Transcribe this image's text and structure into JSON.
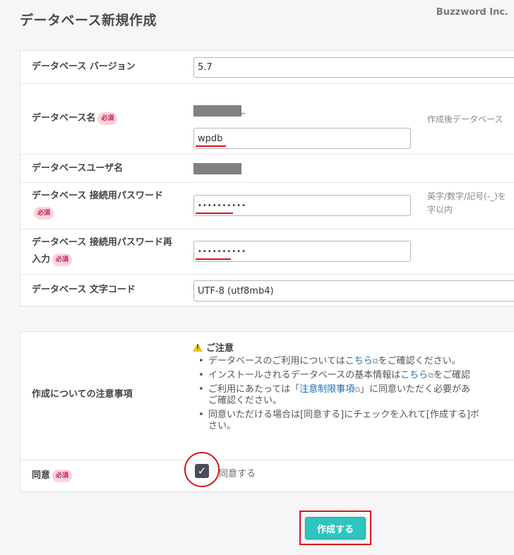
{
  "page": {
    "title": "データベース新規作成",
    "brand": "Buzzword Inc."
  },
  "form": {
    "required_badge": "必須",
    "version": {
      "label": "データベース バージョン",
      "value": "5.7"
    },
    "db_name": {
      "label": "データベース名",
      "prefix_suffix": "_",
      "value": "wpdb",
      "hint": "作成後データベース"
    },
    "db_user": {
      "label": "データベースユーザ名"
    },
    "password": {
      "label": "データベース 接続用パスワード",
      "value": "••••••••••",
      "hint_line1": "英字/数字/記号(-_)を",
      "hint_line2": "字以内"
    },
    "password_confirm": {
      "label": "データベース 接続用パスワード再入力",
      "value": "••••••••••"
    },
    "charset": {
      "label": "データベース 文字コード",
      "value": "UTF-8 (utf8mb4)"
    }
  },
  "notice": {
    "label": "作成についての注意事項",
    "title": "ご注意",
    "items": [
      {
        "before": "データベースのご利用については",
        "link": "こちら",
        "after": "をご確認ください。"
      },
      {
        "before": "インストールされるデータベースの基本情報は",
        "link": "こちら",
        "after": "をご確認"
      },
      {
        "before": "ご利用にあたっては「",
        "link": "注意制限事項",
        "after": "」に同意いただく必要があ",
        "line2": "ご確認ください。"
      },
      {
        "before": "同意いただける場合は[同意する]にチェックを入れて[作成する]ボ",
        "line2": "さい。"
      }
    ]
  },
  "agree": {
    "label": "同意",
    "checkbox_label": "同意する",
    "checked": true
  },
  "submit": {
    "label": "作成する"
  },
  "colors": {
    "accent": "#2ec5c0",
    "required_bg": "#fbd3dc",
    "highlight": "#d8141c",
    "link": "#1a6fb5"
  },
  "icons": {
    "external_link": "external-link-icon",
    "warning": "warning-icon",
    "check": "check-icon"
  }
}
